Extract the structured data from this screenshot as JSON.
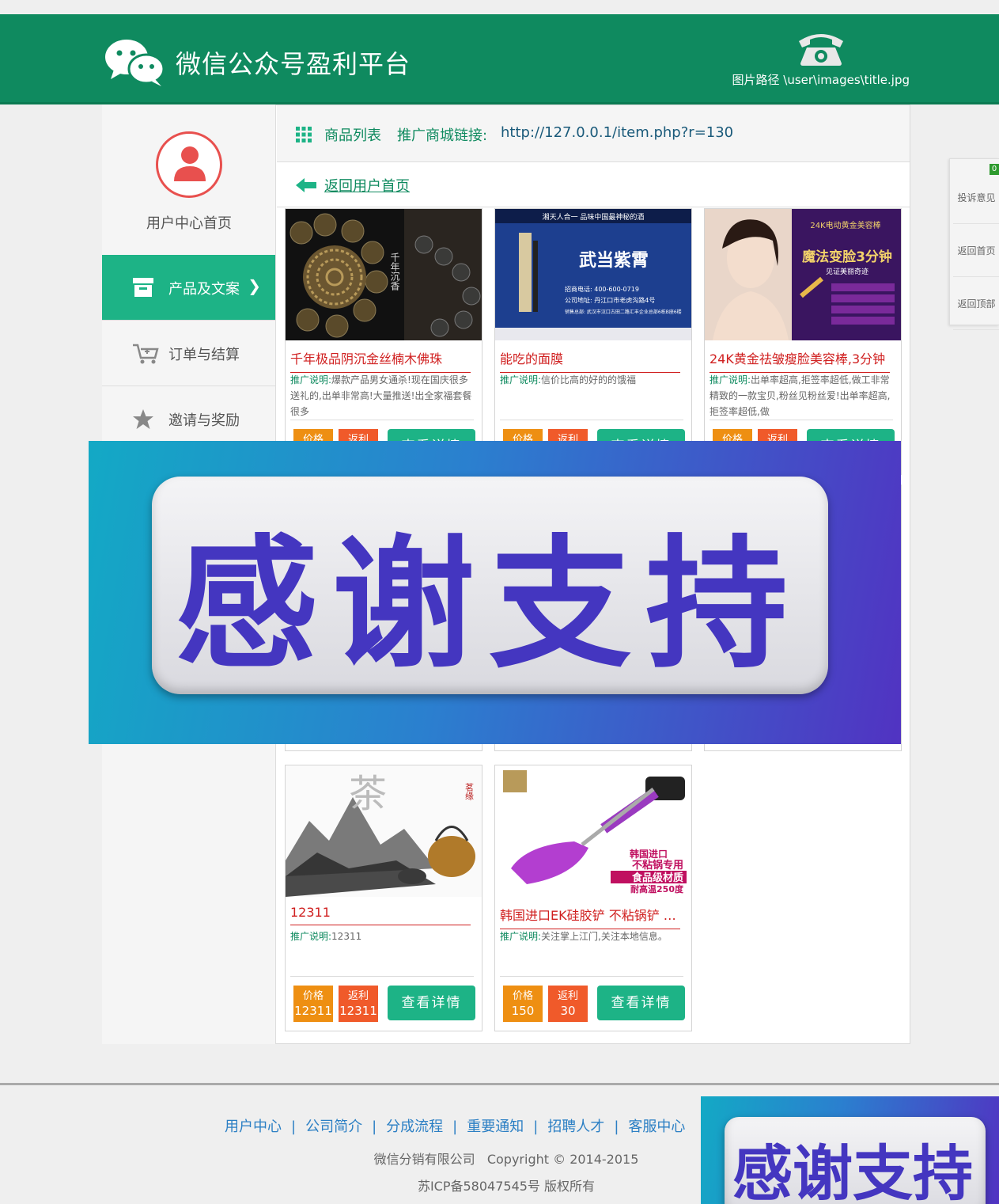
{
  "header": {
    "title": "微信公众号盈利平台",
    "path_text": "图片路径 \\user\\images\\title.jpg"
  },
  "sidebar": {
    "home_label": "用户中心首页",
    "items": [
      {
        "label": "产品及文案",
        "arrow": "❯"
      },
      {
        "label": "订单与结算"
      },
      {
        "label": "邀请与奖励"
      }
    ]
  },
  "topbar": {
    "list_title": "商品列表",
    "link_label": "推广商城链接:",
    "link_url": "http://127.0.0.1/item.php?r=130"
  },
  "back_link": "返回用户首页",
  "products": [
    {
      "name": "千年极品阴沉金丝楠木佛珠",
      "desc_key": "推广说明:",
      "desc": "爆款产品男女通杀!现在国庆很多送礼的,出单非常高!大量推送!出全家福套餐很多",
      "price_label": "价格",
      "rebate_label": "返利",
      "detail": "查看详情"
    },
    {
      "name": "能吃的面膜",
      "desc_key": "推广说明:",
      "desc": "信价比高的好的的饿福",
      "price_label": "价格",
      "rebate_label": "返利",
      "detail": "查看详情"
    },
    {
      "name": "24K黄金祛皱瘦脸美容棒,3分钟",
      "desc_key": "推广说明:",
      "desc": "出单率超高,拒签率超低,做工非常精致的一款宝贝,粉丝见粉丝爱!出单率超高,拒签率超低,做",
      "price_label": "价格",
      "rebate_label": "返利",
      "detail": "查看详情"
    },
    {
      "name": "12311",
      "desc_key": "推广说明:",
      "desc": "12311",
      "price_label": "价格",
      "price": "12311",
      "rebate_label": "返利",
      "rebate": "12311",
      "detail": "查看详情"
    },
    {
      "name": "韩国进口EK硅胶铲 不粘锅铲 天然",
      "desc_key": "推广说明:",
      "desc": "关注掌上江门,关注本地信息。",
      "price_label": "价格",
      "price": "150",
      "rebate_label": "返利",
      "rebate": "30",
      "detail": "查看详情"
    }
  ],
  "product_image_text": {
    "beads": "千年沉香",
    "wine_top": "湘天人合一  品味中国最神秘的酒",
    "wine_brand": "武当紫霄",
    "wine_phone": "招商电话: 400-600-0719",
    "wine_addr": "公司地址: 丹江口市老虎沟路4号",
    "wine_sales": "销售总部: 武汉市汉口古田二路汇丰企业总部6栋B座6楼",
    "beauty_top": "24K电动黄金美容棒",
    "beauty_headline": "魔法变脸3分钟",
    "beauty_sub": "见证美丽奇迹",
    "tea_char": "茶",
    "tea_seal": "茗缘",
    "spatula_1": "韩国进口",
    "spatula_2": "不粘锅专用",
    "spatula_3": "食品级材质",
    "spatula_4": "耐高温250度"
  },
  "right_panel": {
    "badge": "0",
    "items": [
      "投诉意见",
      "返回首页",
      "返回顶部"
    ]
  },
  "footer": {
    "links": [
      "用户中心",
      "公司简介",
      "分成流程",
      "重要通知",
      "招聘人才",
      "客服中心"
    ],
    "copyright": "微信分销有限公司   Copyright © 2014-2015",
    "icp": "苏ICP备58047545号 版权所有"
  },
  "banner_text": "感谢支持",
  "colors": {
    "brand_green": "#0f8a5f",
    "accent_green": "#1db386",
    "price_orange": "#ee8f12",
    "rebate_red": "#f05a2a",
    "name_red": "#d02020",
    "banner_text": "#4436c0"
  }
}
